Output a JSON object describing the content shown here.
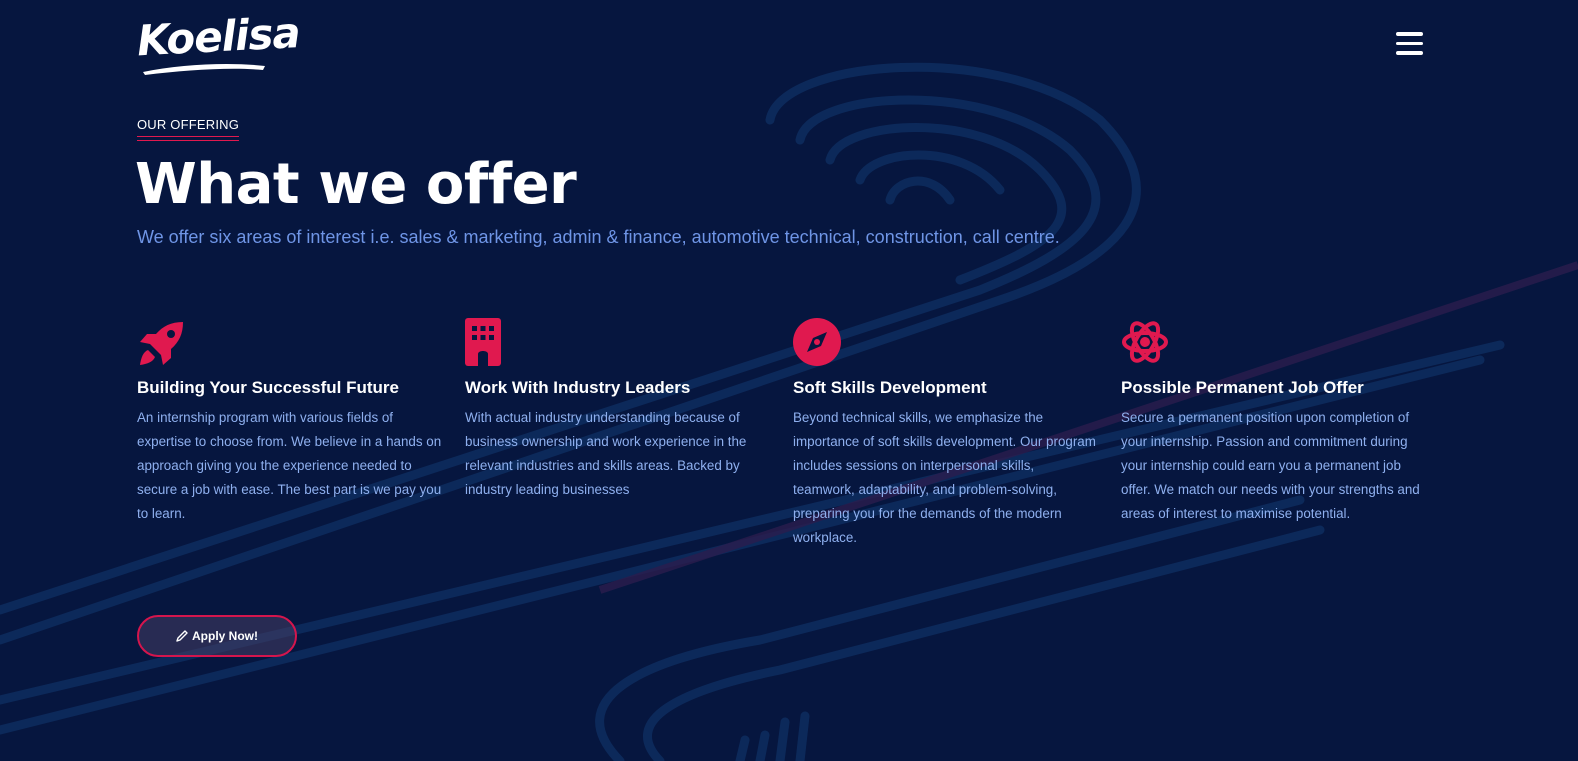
{
  "brand": {
    "logo_text": "Koelisa"
  },
  "header": {
    "menu_icon": "hamburger-menu-icon"
  },
  "section": {
    "eyebrow": "OUR OFFERING",
    "title": "What we offer",
    "subtitle": "We offer six areas of interest i.e. sales & marketing, admin & finance, automotive technical, construction, call centre."
  },
  "features": [
    {
      "icon": "rocket-icon",
      "title": "Building Your Successful Future",
      "text": "An internship program with various fields of expertise to choose from. We believe in a hands on approach giving you the experience needed to secure a job with ease. The best part is we pay you to learn."
    },
    {
      "icon": "building-icon",
      "title": "Work With Industry Leaders",
      "text": "With actual industry understanding because of business ownership and work experience in the relevant industries and skills areas. Backed by industry leading businesses"
    },
    {
      "icon": "compass-icon",
      "title": "Soft Skills Development",
      "text": "Beyond technical skills, we emphasize the importance of soft skills development. Our program includes sessions on interpersonal skills, teamwork, adaptability, and problem-solving, preparing you for the demands of the modern workplace."
    },
    {
      "icon": "atom-icon",
      "title": "Possible Permanent Job Offer",
      "text": "Secure a permanent position upon completion of your internship. Passion and commitment during your internship could earn you a permanent job offer. We match our needs with your strengths and areas of interest to maximise potential."
    }
  ],
  "cta": {
    "label": "Apply Now!",
    "icon": "pencil-icon"
  },
  "colors": {
    "background": "#06163f",
    "accent": "#e0194f",
    "subtitle": "#6f95e6",
    "body_text": "#8fb0ef"
  }
}
